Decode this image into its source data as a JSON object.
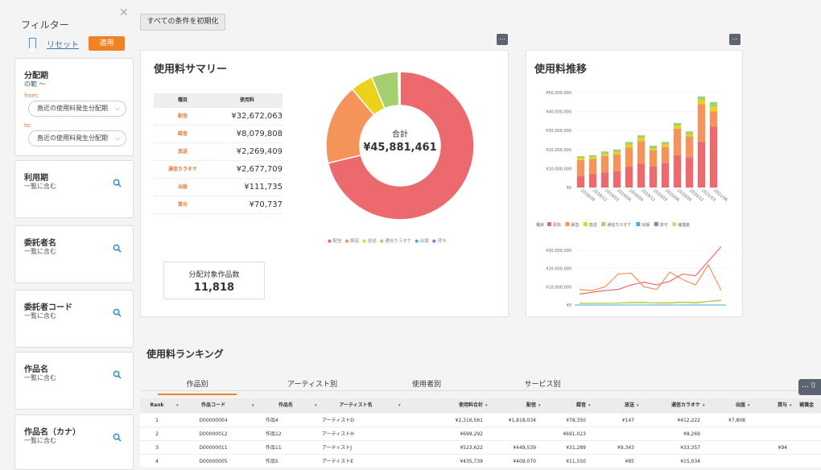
{
  "sidebar": {
    "title": "フィルター",
    "reset_label": "リセット",
    "apply_label": "適用",
    "period": {
      "label": "分配期",
      "sub": "の範 ～",
      "from_label": "from:",
      "from_value": "直近の使用料発生分配期",
      "to_label": "to:",
      "to_value": "直近の使用料発生分配期"
    },
    "filters": [
      {
        "label": "利用期",
        "sub": "一覧に含む"
      },
      {
        "label": "委託者名",
        "sub": "一覧に含む"
      },
      {
        "label": "委託者コード",
        "sub": "一覧に含む"
      },
      {
        "label": "作品名",
        "sub": "一覧に含む"
      },
      {
        "label": "作品名（カナ）",
        "sub": "一覧に含む"
      }
    ]
  },
  "toolbar": {
    "reset_all_label": "すべての条件を初期化",
    "more_label": "..."
  },
  "summary": {
    "title": "使用料サマリー",
    "table_headers": [
      "種目",
      "使用料"
    ],
    "rows": [
      {
        "category": "配信",
        "amount": "¥32,672,063"
      },
      {
        "category": "録音",
        "amount": "¥8,079,808"
      },
      {
        "category": "放送",
        "amount": "¥2,269,409"
      },
      {
        "category": "通信カラオケ",
        "amount": "¥2,677,709"
      },
      {
        "category": "出版",
        "amount": "¥111,735"
      },
      {
        "category": "貸与",
        "amount": "¥70,737"
      }
    ],
    "total_label": "合計",
    "total_value": "¥45,881,461",
    "legend": [
      "配信",
      "録音",
      "放送",
      "通信カラオケ",
      "出版",
      "貸与"
    ],
    "works_label": "分配対象作品数",
    "works_value": "11,818"
  },
  "trend": {
    "title": "使用料推移",
    "legend_prefix": "種目",
    "legend": [
      "配信",
      "録音",
      "放送",
      "通信カラオケ",
      "出版",
      "貸与",
      "補償金"
    ]
  },
  "chart_data": [
    {
      "type": "pie",
      "title": "使用料サマリー",
      "categories": [
        "配信",
        "録音",
        "放送",
        "通信カラオケ",
        "出版",
        "貸与"
      ],
      "values": [
        32672063,
        8079808,
        2269409,
        2677709,
        111735,
        70737
      ],
      "colors": [
        "#ec6a6e",
        "#f4935a",
        "#ecd21a",
        "#a5d06f",
        "#4ea8de",
        "#a06cd5"
      ]
    },
    {
      "type": "bar",
      "title": "使用料推移",
      "categories": [
        "2018/09",
        "2018/12",
        "2019/03",
        "2019/06",
        "2019/09",
        "2019/12",
        "2020/03",
        "2020/06",
        "2020/09",
        "2020/12",
        "2021/03",
        "2021/06"
      ],
      "series": [
        {
          "name": "配信",
          "values": [
            6000000,
            7000000,
            8000000,
            8500000,
            11000000,
            12500000,
            11000000,
            13000000,
            17000000,
            16000000,
            24000000,
            32000000
          ]
        },
        {
          "name": "録音",
          "values": [
            8500000,
            8000000,
            8500000,
            9000000,
            10000000,
            12000000,
            8500000,
            8500000,
            14000000,
            11000000,
            20000000,
            8000000
          ]
        },
        {
          "name": "放送",
          "values": [
            1000000,
            1000000,
            1000000,
            1000000,
            1500000,
            1500000,
            1000000,
            1000000,
            1500000,
            1000000,
            2000000,
            2300000
          ]
        },
        {
          "name": "通信カラオケ",
          "values": [
            1000000,
            1000000,
            1500000,
            1500000,
            1500000,
            1500000,
            1500000,
            1500000,
            1500000,
            1500000,
            2000000,
            2700000
          ]
        }
      ],
      "ylim": [
        0,
        50000000
      ],
      "yticks": [
        "¥50,000,000",
        "¥40,000,000",
        "¥30,000,000",
        "¥20,000,000",
        "¥10,000,000",
        "¥0"
      ]
    },
    {
      "type": "line",
      "categories": [
        "2018/09",
        "2018/12",
        "2019/03",
        "2019/06",
        "2019/09",
        "2019/12",
        "2020/03",
        "2020/06",
        "2020/09",
        "2020/12",
        "2021/03",
        "2021/06"
      ],
      "series": [
        {
          "name": "配信",
          "values": [
            6000000,
            7000000,
            8000000,
            8500000,
            11000000,
            12500000,
            11000000,
            13000000,
            17000000,
            16000000,
            24000000,
            32000000
          ]
        },
        {
          "name": "録音",
          "values": [
            8500000,
            8000000,
            10000000,
            17000000,
            17500000,
            10000000,
            8500000,
            18000000,
            14000000,
            11000000,
            22000000,
            8000000
          ]
        },
        {
          "name": "放送",
          "values": [
            1000000,
            1000000,
            1000000,
            1000000,
            1500000,
            1500000,
            1000000,
            1000000,
            1500000,
            1000000,
            2000000,
            2300000
          ]
        },
        {
          "name": "通信カラオケ",
          "values": [
            800000,
            900000,
            1000000,
            1100000,
            1200000,
            1300000,
            1200000,
            1300000,
            1500000,
            1400000,
            2000000,
            2700000
          ]
        }
      ],
      "ylim": [
        0,
        30000000
      ],
      "yticks": [
        "¥30,000,000",
        "¥20,000,000",
        "¥10,000,000",
        "¥0"
      ]
    }
  ],
  "ranking": {
    "title": "使用料ランキング",
    "tabs": [
      "作品別",
      "アーティスト別",
      "使用者別",
      "サービス別"
    ],
    "headers": [
      "Rank",
      "作品コード",
      "作品名",
      "アーティスト名",
      "使用料合計",
      "配信",
      "録音",
      "放送",
      "通信カラオケ",
      "出版",
      "貸与",
      "補償金"
    ],
    "rows": [
      [
        "1",
        "D00000004",
        "作品4",
        "アーティストD",
        "¥2,316,561",
        "¥1,818,034",
        "¥78,350",
        "¥147",
        "¥412,222",
        "¥7,808",
        "",
        ""
      ],
      [
        "2",
        "D00000012",
        "作品12",
        "アーティストH",
        "¥699,292",
        "",
        "¥691,023",
        "",
        "¥8,269",
        "",
        "",
        ""
      ],
      [
        "3",
        "D00000011",
        "作品11",
        "アーティストJ",
        "¥523,622",
        "¥449,539",
        "¥31,289",
        "¥9,343",
        "¥33,357",
        "",
        "¥94",
        ""
      ],
      [
        "4",
        "D00000005",
        "作品5",
        "アーティストE",
        "¥435,739",
        "¥409,070",
        "¥11,550",
        "¥85",
        "¥15,034",
        "",
        "",
        ""
      ]
    ]
  }
}
